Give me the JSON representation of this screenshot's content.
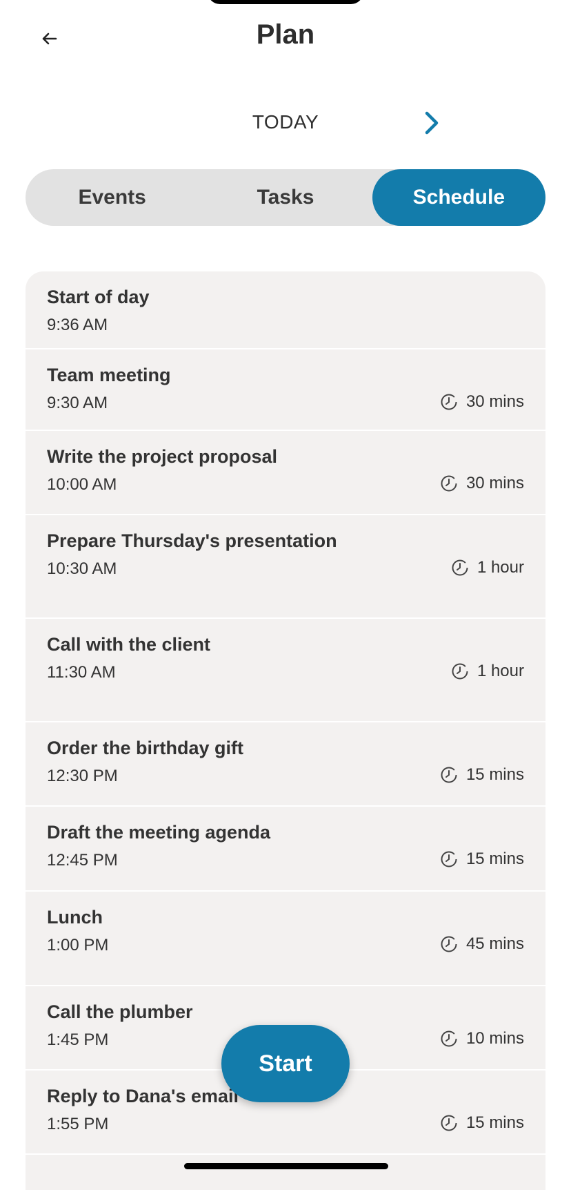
{
  "header": {
    "title": "Plan",
    "back_icon": "arrow-left-icon"
  },
  "day_nav": {
    "label": "TODAY",
    "next_icon": "chevron-right-icon"
  },
  "tabs": [
    {
      "label": "Events",
      "active": false
    },
    {
      "label": "Tasks",
      "active": false
    },
    {
      "label": "Schedule",
      "active": true
    }
  ],
  "schedule": [
    {
      "title": "Start of day",
      "time": "9:36 AM",
      "duration": ""
    },
    {
      "title": "Team meeting",
      "time": "9:30 AM",
      "duration": "30 mins"
    },
    {
      "title": "Write the project proposal",
      "time": "10:00 AM",
      "duration": "30 mins"
    },
    {
      "title": "Prepare Thursday's presentation",
      "time": "10:30 AM",
      "duration": "1 hour"
    },
    {
      "title": "Call with the client",
      "time": "11:30 AM",
      "duration": "1 hour"
    },
    {
      "title": "Order the birthday gift",
      "time": "12:30 PM",
      "duration": "15 mins"
    },
    {
      "title": "Draft the meeting agenda",
      "time": "12:45 PM",
      "duration": "15 mins"
    },
    {
      "title": "Lunch",
      "time": "1:00 PM",
      "duration": "45 mins"
    },
    {
      "title": "Call the plumber",
      "time": "1:45 PM",
      "duration": "10 mins"
    },
    {
      "title": "Reply to Dana's email",
      "time": "1:55 PM",
      "duration": "15 mins"
    }
  ],
  "start_button": {
    "label": "Start"
  },
  "colors": {
    "accent": "#137cab",
    "segment_bg": "#e2e2e2",
    "list_bg": "#f3f1f0",
    "text": "#333333"
  }
}
